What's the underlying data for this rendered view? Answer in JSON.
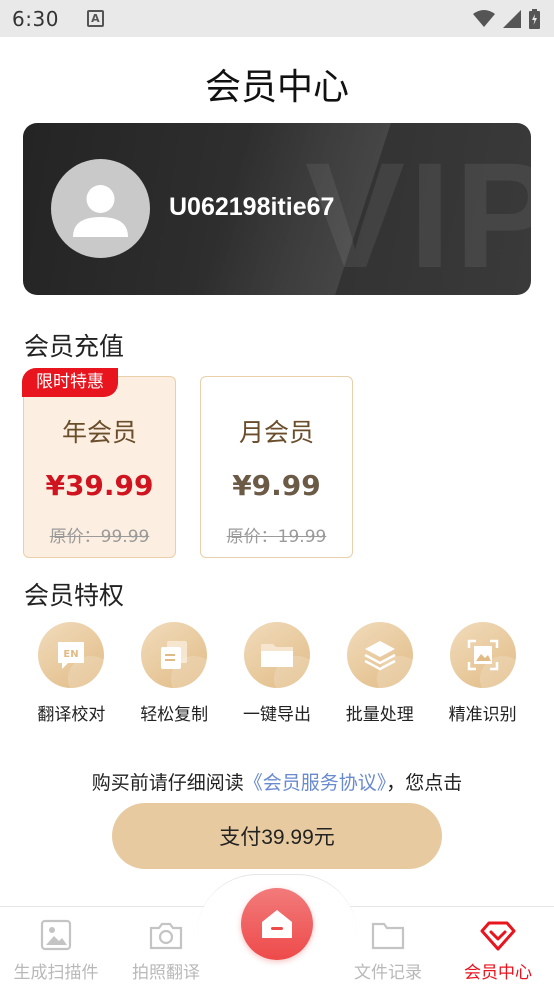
{
  "status_bar": {
    "time": "6:30",
    "notification_letter": "A"
  },
  "header": {
    "title": "会员中心"
  },
  "user_card": {
    "username": "U062198itie67",
    "watermark": "VIP"
  },
  "recharge": {
    "title": "会员充值",
    "badge": "限时特惠",
    "plans": [
      {
        "name": "年会员",
        "price": "¥39.99",
        "original": "原价：99.99",
        "selected": true
      },
      {
        "name": "月会员",
        "price": "¥9.99",
        "original": "原价：19.99",
        "selected": false
      }
    ]
  },
  "privileges": {
    "title": "会员特权",
    "items": [
      {
        "label": "翻译校对",
        "icon": "en-translate-icon"
      },
      {
        "label": "轻松复制",
        "icon": "copy-icon"
      },
      {
        "label": "一键导出",
        "icon": "folder-icon"
      },
      {
        "label": "批量处理",
        "icon": "layers-icon"
      },
      {
        "label": "精准识别",
        "icon": "scan-image-icon"
      }
    ]
  },
  "agreement": {
    "prefix": "购买前请仔细阅读",
    "link": "《会员服务协议》",
    "suffix": "，您点击"
  },
  "pay_button": {
    "label": "支付39.99元"
  },
  "bottom_nav": {
    "items": [
      {
        "label": "生成扫描件",
        "icon": "image-icon"
      },
      {
        "label": "拍照翻译",
        "icon": "camera-icon"
      },
      {
        "label": "文件记录",
        "icon": "folder-icon"
      },
      {
        "label": "会员中心",
        "icon": "diamond-icon",
        "active": true
      }
    ]
  },
  "colors": {
    "accent": "#e8141e",
    "gold": "#e8caa0",
    "card_dark": "#2e2e2e",
    "link": "#6a8ad0"
  }
}
